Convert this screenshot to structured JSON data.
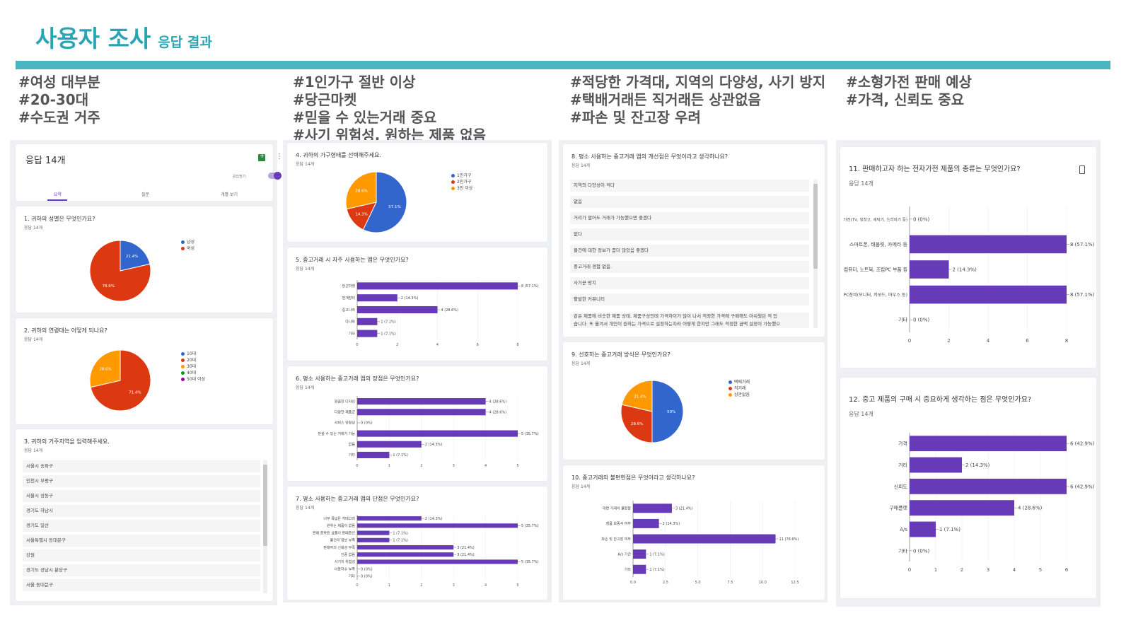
{
  "header": {
    "title": "사용자 조사",
    "subtitle": "응답 결과"
  },
  "tags": {
    "col1": [
      "#여성 대부분",
      "#20-30대",
      "#수도권 거주"
    ],
    "col2": [
      "#1인가구 절반 이상",
      "#당근마켓",
      "#믿을 수 있는거래 중요",
      "#사기 위험성, 원하는 제품 없음"
    ],
    "col3": [
      "#적당한 가격대, 지역의 다양성, 사기 방지",
      "#택배거래든 직거래든 상관없음",
      "#파손 및 잔고장 우려"
    ],
    "col4": [
      "#소형가전 판매 예상",
      "#가격, 신뢰도 중요"
    ]
  },
  "summary": {
    "title": "응답 14개",
    "tabs": [
      "요약",
      "질문",
      "개별 보기"
    ],
    "toggle_label": "응답받기"
  },
  "colors": {
    "accent": "#2aa3b4",
    "bar": "#673ab7",
    "blue": "#3366cc",
    "red": "#dc3912",
    "orange": "#ff9900",
    "green": "#109618",
    "purple": "#990099"
  },
  "q3": {
    "title": "3. 귀하의 거주지역을 입력해주세요.",
    "count": "응답 14개",
    "items": [
      "서울시 송파구",
      "인천시 부평구",
      "서울시 성동구",
      "경기도 하남시",
      "경기도 일산",
      "서울특별시 동대문구",
      "강원",
      "경기도 성남시 분당구",
      "서울 동대문구"
    ]
  },
  "q8": {
    "title": "8. 평소 사용하는 중고거래 앱의 개선점은 무엇이라고 생각하나요?",
    "count": "응답 14개",
    "items": [
      "지역의 다양성이 적다",
      "없음",
      "거리가 멀어도 거래가 가능했으면 좋겠다",
      "없다",
      "물건에 대한 정보가 좀더 많았음 좋겠다",
      "중고거래 경험 없음.",
      "사기꾼 방지",
      "활발한 커뮤니티",
      "같은 제품에 비슷한 제품 상태, 제품구성인데 가격차이가 많이 나서 적정한 가격에 구매해도 아쉬웠던 적 있",
      "습니다. 또 옮겨서 개인이 원하는 가격으로 설정하는지라 어떻게 한지만 그래도 적정한 금액 설정이 가능했으"
    ]
  },
  "chart_data": [
    {
      "id": "q1",
      "type": "pie",
      "title": "1. 귀하의 성별은 무엇인가요?",
      "count": "응답 14개",
      "categories": [
        "남성",
        "여성"
      ],
      "values": [
        21.4,
        78.6
      ],
      "labels": [
        "21.4%",
        "78.6%"
      ]
    },
    {
      "id": "q2",
      "type": "pie",
      "title": "2. 귀하의 연령대는 어떻게 되나요?",
      "count": "응답 14개",
      "categories": [
        "10대",
        "20대",
        "30대",
        "40대",
        "50대 이상"
      ],
      "values": [
        0,
        71.4,
        28.6,
        0,
        0
      ],
      "labels": [
        "",
        "71.4%",
        "28.6%",
        "",
        ""
      ]
    },
    {
      "id": "q4",
      "type": "pie",
      "title": "4. 귀하의 가구형태를 선택해주세요.",
      "count": "응답 14개",
      "categories": [
        "1인가구",
        "2인가구",
        "3인 이상"
      ],
      "values": [
        57.1,
        14.3,
        28.6
      ],
      "labels": [
        "57.1%",
        "14.3%",
        "28.6%"
      ]
    },
    {
      "id": "q5",
      "type": "bar",
      "title": "5. 중고거래 시 자주 사용하는 앱은 무엇인가요?",
      "count": "응답 14개",
      "categories": [
        "당근마켓",
        "번개장터",
        "중고나라",
        "다나와",
        "기타"
      ],
      "values": [
        8,
        2,
        4,
        1,
        1
      ],
      "labels": [
        "8 (57.1%)",
        "2 (14.3%)",
        "4 (28.6%)",
        "1 (7.1%)",
        "1 (7.1%)"
      ],
      "xticks": [
        "0",
        "2",
        "4",
        "6",
        "8"
      ],
      "xlim": [
        0,
        8
      ]
    },
    {
      "id": "q6",
      "type": "bar",
      "title": "6. 평소 사용하는 중고거래 앱의 장점은 무엇인가요?",
      "count": "응답 14개",
      "categories": [
        "깔끔한 디자인",
        "다양한 제품군",
        "서비스 안정성",
        "믿을 수 있는 거래가 가능",
        "없음",
        "기타"
      ],
      "values": [
        4,
        4,
        0,
        5,
        2,
        1
      ],
      "labels": [
        "4 (28.6%)",
        "4 (28.6%)",
        "0 (0%)",
        "5 (35.7%)",
        "2 (14.3%)",
        "1 (7.1%)"
      ],
      "xticks": [
        "0",
        "1",
        "2",
        "3",
        "4",
        "5"
      ],
      "xlim": [
        0,
        5
      ]
    },
    {
      "id": "q7",
      "type": "bar",
      "title": "7. 평소 사용하는 중고거래 앱의 단점은 무엇인가요?",
      "count": "응답 14개",
      "categories": [
        "너무 폭넓은 카테고리",
        "원하는 제품이 없음",
        "판매 중복된 상품이 판매중인",
        "물건의 정보 부족",
        "판매자의 신뢰성 부족",
        "인증 없음",
        "사기의 위험성",
        "이용자수 부족",
        "기타"
      ],
      "values": [
        2,
        5,
        1,
        1,
        3,
        3,
        5,
        0,
        0
      ],
      "labels": [
        "2 (14.3%)",
        "5 (35.7%)",
        "1 (7.1%)",
        "1 (7.1%)",
        "3 (21.4%)",
        "3 (21.4%)",
        "5 (35.7%)",
        "0 (0%)",
        "0 (0%)"
      ],
      "xticks": [
        "0",
        "1",
        "2",
        "3",
        "4",
        "5"
      ],
      "xlim": [
        0,
        5
      ]
    },
    {
      "id": "q9",
      "type": "pie",
      "title": "9. 선호하는 중고거래 방식은 무엇인가요?",
      "count": "응답 14개",
      "categories": [
        "택배거래",
        "직거래",
        "상관없음"
      ],
      "values": [
        50,
        28.6,
        21.4
      ],
      "labels": [
        "50%",
        "28.6%",
        "21.4%"
      ]
    },
    {
      "id": "q10",
      "type": "bar",
      "title": "10. 중고거래의 불편한점은 무엇이라고 생각하나요?",
      "count": "응답 14개",
      "categories": [
        "대면 거래의 불편함",
        "정품 보증서 여부",
        "파손 및 잔고장 여부",
        "A/s 기간",
        "기타"
      ],
      "values": [
        3,
        2,
        11,
        1,
        1
      ],
      "labels": [
        "3 (21.4%)",
        "2 (14.3%)",
        "11 (78.6%)",
        "1 (7.1%)",
        "1 (7.1%)"
      ],
      "xticks": [
        "0.0",
        "2.5",
        "5.0",
        "7.5",
        "10.0",
        "12.5"
      ],
      "xlim": [
        0,
        12.5
      ]
    },
    {
      "id": "q11",
      "type": "bar",
      "title": "11. 판매하고자 하는 전자가전 제품의 종류는 무엇인가요?",
      "count": "응답 14개",
      "categories": [
        "가전(TV, 냉장고, 세탁기, 드라이기 등)",
        "스마트폰, 태블릿, 카메라 등",
        "컴퓨터, 노트북, 조립PC 부품 등",
        "PC장비(모니터, 키보드, 마우스 등)",
        "기타"
      ],
      "values": [
        0,
        8,
        2,
        8,
        0
      ],
      "labels": [
        "0 (0%)",
        "8 (57.1%)",
        "2 (14.3%)",
        "8 (57.1%)",
        "0 (0%)"
      ],
      "xticks": [
        "0",
        "2",
        "4",
        "6",
        "8"
      ],
      "xlim": [
        0,
        8
      ]
    },
    {
      "id": "q12",
      "type": "bar",
      "title": "12. 중고 제품의 구매 시 중요하게 생각하는 점은 무엇인가요?",
      "count": "응답 14개",
      "categories": [
        "가격",
        "거리",
        "신뢰도",
        "구매플랫",
        "A/s",
        "기타"
      ],
      "values": [
        6,
        2,
        6,
        4,
        1,
        0
      ],
      "labels": [
        "6 (42.9%)",
        "2 (14.3%)",
        "6 (42.9%)",
        "4 (28.6%)",
        "1 (7.1%)",
        "0 (0%)"
      ],
      "xticks": [
        "0",
        "1",
        "2",
        "3",
        "4",
        "5",
        "6"
      ],
      "xlim": [
        0,
        6
      ]
    }
  ]
}
